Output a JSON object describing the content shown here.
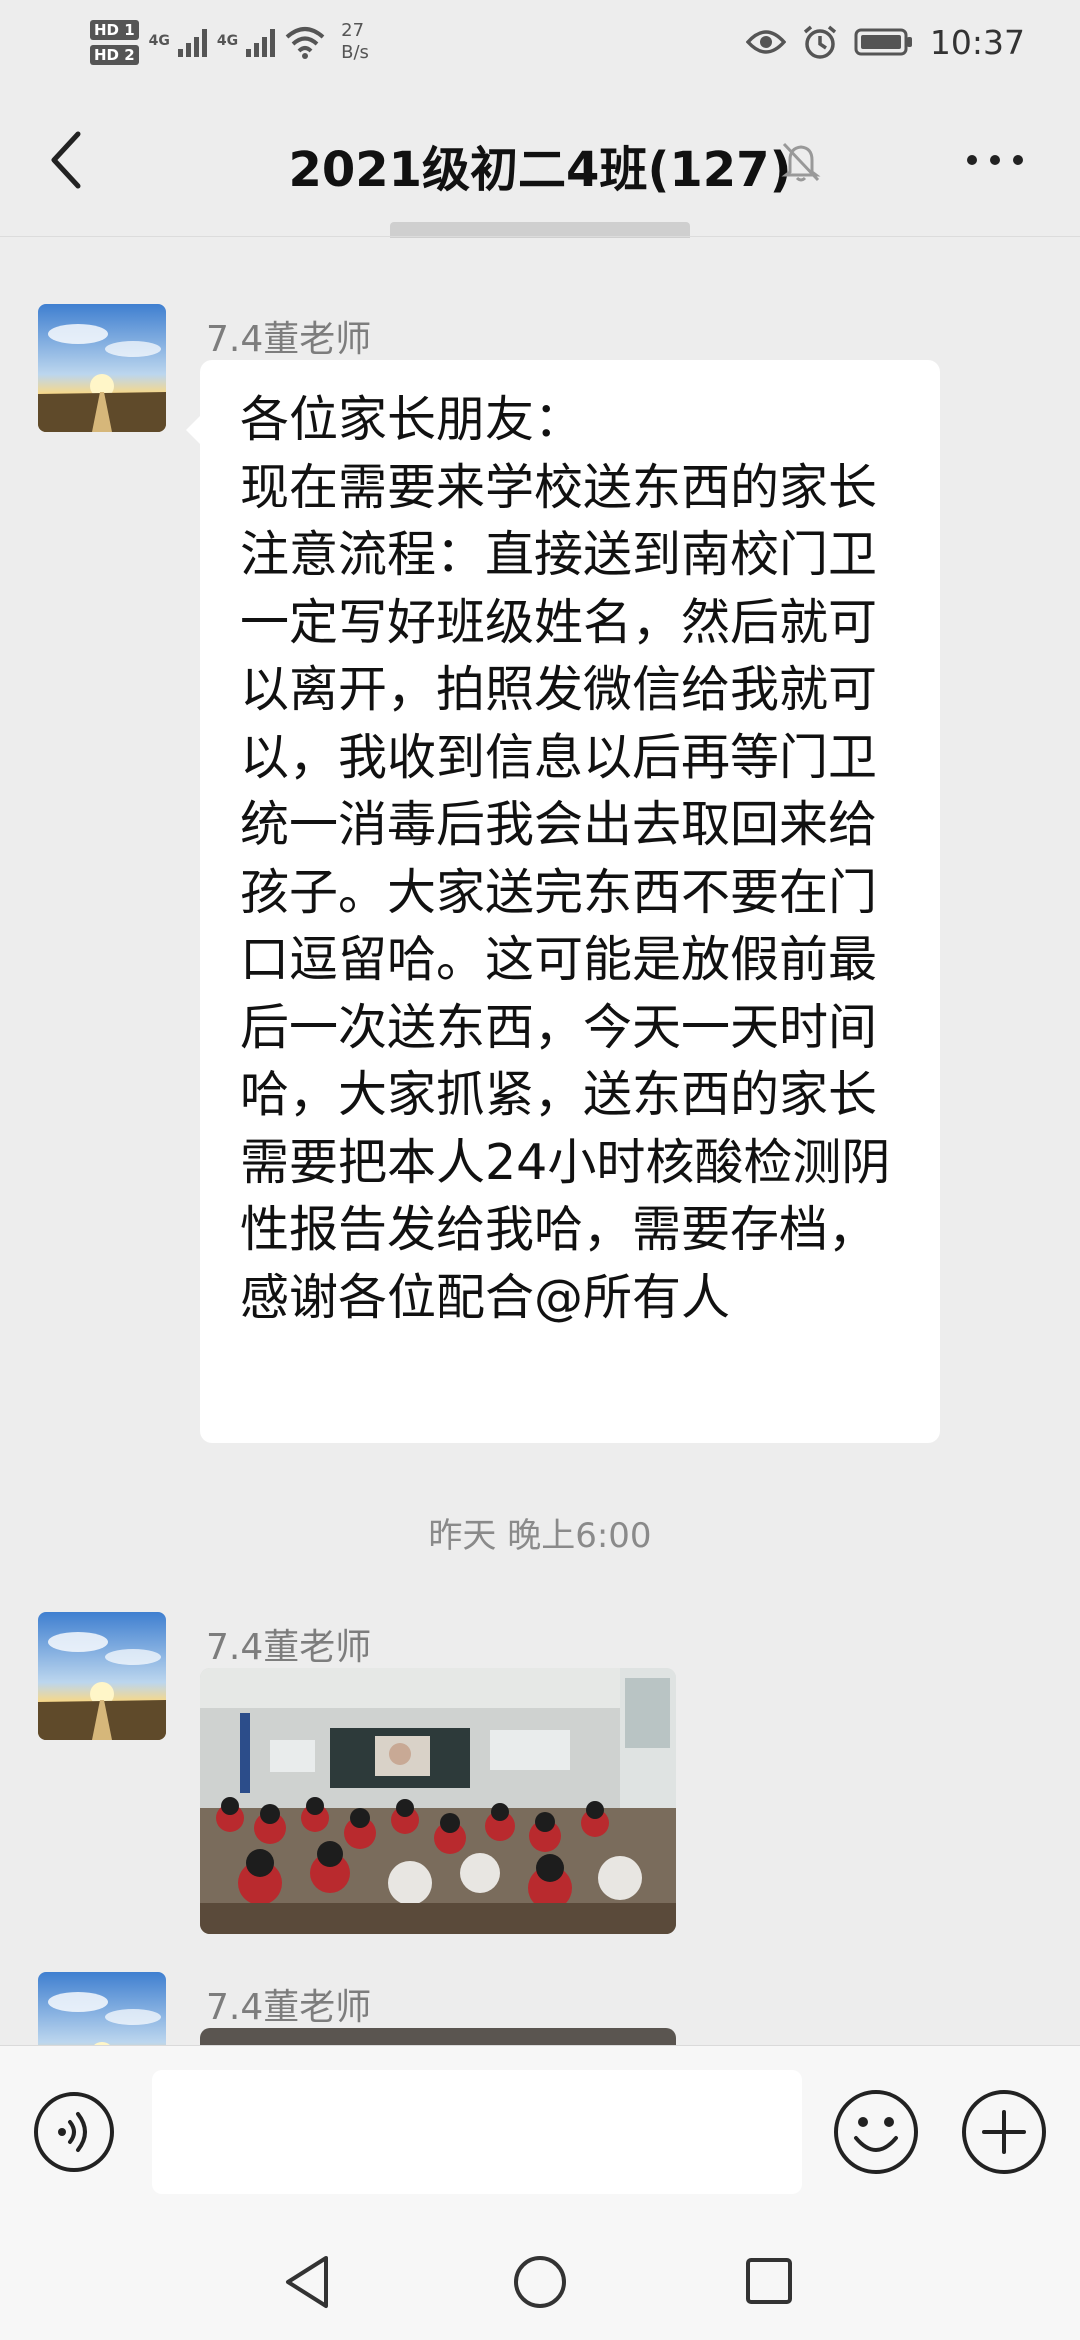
{
  "status_bar": {
    "sim1": "HD 1",
    "sim2": "HD 2",
    "net1": "4G",
    "net2": "4G",
    "speed_value": "27",
    "speed_unit": "B/s",
    "time": "10:37",
    "icons": [
      "eye-icon",
      "alarm-icon",
      "battery-icon",
      "wifi-icon",
      "signal-icon"
    ]
  },
  "header": {
    "title": "2021级初二4班(127)",
    "icons": [
      "back-arrow-icon",
      "bell-muted-icon",
      "more-icon"
    ]
  },
  "messages": [
    {
      "sender": "7.4董老师",
      "text": "各位家长朋友：\n现在需要来学校送东西的家长注意流程：直接送到南校门卫一定写好班级姓名，然后就可以离开，拍照发微信给我就可以，我收到信息以后再等门卫统一消毒后我会出去取回来给孩子。大家送完东西不要在门口逗留哈。这可能是放假前最后一次送东西，今天一天时间哈，大家抓紧，送东西的家长需要把本人24小时核酸检测阴性报告发给我哈，需要存档，感谢各位配合@所有人"
    },
    {
      "timestamp": "昨天 晚上6:00"
    },
    {
      "sender": "7.4董老师",
      "type": "image"
    },
    {
      "sender": "7.4董老师",
      "type": "image"
    }
  ],
  "input_bar": {
    "icons": [
      "voice-icon",
      "emoji-icon",
      "plus-icon"
    ],
    "placeholder": ""
  },
  "nav_bar": {
    "icons": [
      "nav-back-icon",
      "nav-home-icon",
      "nav-recents-icon"
    ]
  },
  "colors": {
    "background": "#ededed",
    "bubble": "#ffffff",
    "sender_text": "#7d7d7d",
    "timestamp_text": "#8a8a8a"
  }
}
